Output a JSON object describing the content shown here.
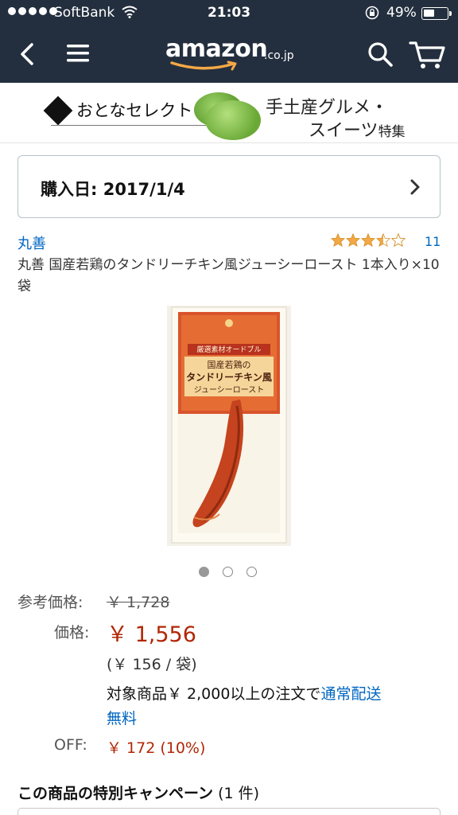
{
  "status_bar": {
    "carrier": "SoftBank",
    "time": "21:03",
    "battery": "49%"
  },
  "nav": {
    "logo_word": "amazon",
    "logo_tld": ".co.jp",
    "icons": [
      "back-icon",
      "menu-icon",
      "search-icon",
      "cart-icon"
    ]
  },
  "banner": {
    "left_text": "おとなセレクト",
    "right_line1": "手土産グルメ・",
    "right_line2": "スイーツ",
    "right_suffix": "特集"
  },
  "purchase": {
    "label": "購入日: 2017/1/4"
  },
  "product": {
    "brand": "丸善",
    "rating": 3.5,
    "rating_count": "11",
    "title": "丸善 国産若鶏のタンドリーチキン風ジューシーロースト 1本入り×10袋",
    "package_line1": "厳選素材オードブル",
    "package_line2": "国産若鶏の",
    "package_line3": "タンドリーチキン風",
    "package_line4": "ジューシーロースト",
    "carousel_count": 3,
    "carousel_active": 0
  },
  "pricing": {
    "ref_label": "参考価格:",
    "ref_value": "￥ 1,728",
    "price_label": "価格:",
    "price_value": "￥ 1,556",
    "unit_price": "(￥ 156 / 袋)",
    "shipping_text": "対象商品￥ 2,000以上の注文で",
    "shipping_link_1": "通常配送",
    "shipping_link_2": "無料",
    "off_label": "OFF:",
    "off_value": "￥ 172 (10%)"
  },
  "campaign": {
    "title": "この商品の特別キャンペーン",
    "count": "(1 件)"
  },
  "colors": {
    "header_bg": "#232f3e",
    "link": "#0066c0",
    "price": "#b12704",
    "star": "#f3a847"
  }
}
